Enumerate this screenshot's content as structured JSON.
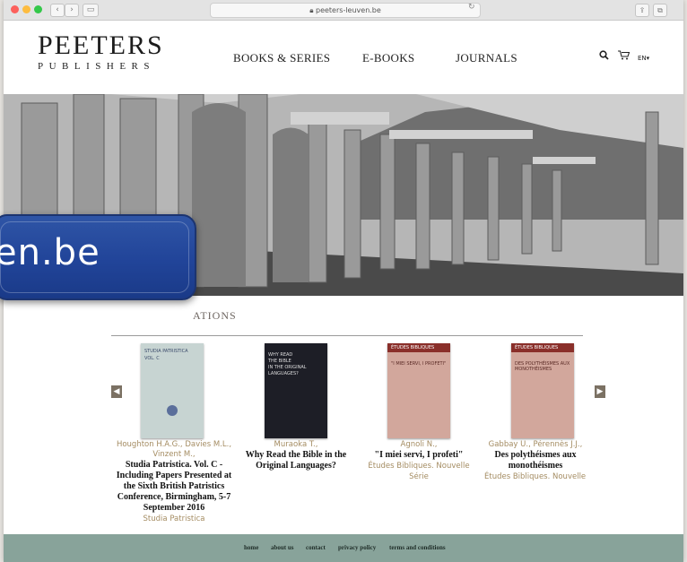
{
  "browser": {
    "address": "peeters-leuven.be",
    "back_glyph": "‹",
    "forward_glyph": "›",
    "reload_glyph": "↻",
    "share_glyph": "⇪",
    "tabs_glyph": "⧉"
  },
  "header": {
    "logo_title": "PEETERS",
    "logo_subtitle": "PUBLISHERS",
    "nav": [
      "BOOKS & SERIES",
      "E-BOOKS",
      "JOURNALS"
    ],
    "search_icon": "search-icon",
    "cart_icon": "cart-icon",
    "language": "EN▾"
  },
  "main": {
    "section_heading": "ATIONS",
    "prev_arrow": "◀",
    "next_arrow": "▶",
    "books": [
      {
        "author": "Houghton H.A.G., Davies M.L., Vinzent M.,",
        "title": "Studia Patristica. Vol. C - Including Papers Presented at the Sixth British Patristics Conference, Birmingham, 5-7 September 2016",
        "series": "Studia Patristica",
        "cover_color": "#c7d4d2",
        "cover_lines": [
          "STUDIA PATRISTICA",
          "VOL. C"
        ]
      },
      {
        "author": "Muraoka T.,",
        "title": "Why Read the Bible in the Original Languages?",
        "series": "",
        "cover_color": "#1d1e26",
        "cover_lines": [
          "WHY READ",
          "THE BIBLE",
          "IN THE ORIGINAL",
          "LANGUAGES?"
        ]
      },
      {
        "author": "Agnoli N.,",
        "title": "\"I miei servi, I profeti\"",
        "series": "Études Bibliques. Nouvelle Série",
        "cover_color": "#d2a79c",
        "cover_lines": [
          "ÉTUDES BIBLIQUES",
          "\"I MIEI SERVI, I PROFETI\""
        ]
      },
      {
        "author": "Gabbay U., Pérennès J.J.,",
        "title": "Des polythéismes aux monothéismes",
        "series": "Études Bibliques. Nouvelle S",
        "cover_color": "#d2a79c",
        "cover_lines": [
          "ÉTUDES BIBLIQUES",
          "DES POLYTHÉISMES AUX MONOTHÉISMES"
        ]
      }
    ]
  },
  "footer": {
    "links": [
      "home",
      "about us",
      "contact",
      "privacy policy",
      "terms and conditions"
    ]
  },
  "overlay": {
    "text": "en.be"
  },
  "colors": {
    "accent": "#a48c62",
    "footer": "#88a39a",
    "badge": "#214499"
  }
}
